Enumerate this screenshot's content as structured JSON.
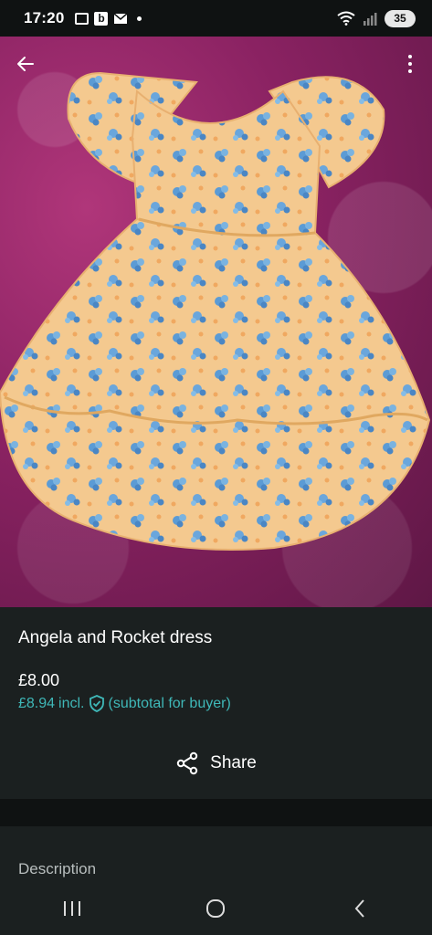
{
  "status_bar": {
    "time": "17:20",
    "notification_icons": [
      "screenshot-icon",
      "b-app-icon",
      "mail-icon",
      "dot-icon"
    ],
    "b_letter": "b",
    "battery": "35"
  },
  "photo": {
    "background_color": "#8a2262",
    "dress_color": "#f4c98f",
    "flower_color": "#5b9bd5"
  },
  "listing": {
    "title": "Angela and Rocket dress",
    "price": "£8.00",
    "buyer_price": "£8.94",
    "incl_label": "incl.",
    "subtotal_label": "(subtotal for buyer)"
  },
  "share": {
    "label": "Share"
  },
  "description": {
    "label": "Description"
  },
  "colors": {
    "accent": "#3fb8b8",
    "panel": "#1b2020",
    "background": "#111514"
  }
}
